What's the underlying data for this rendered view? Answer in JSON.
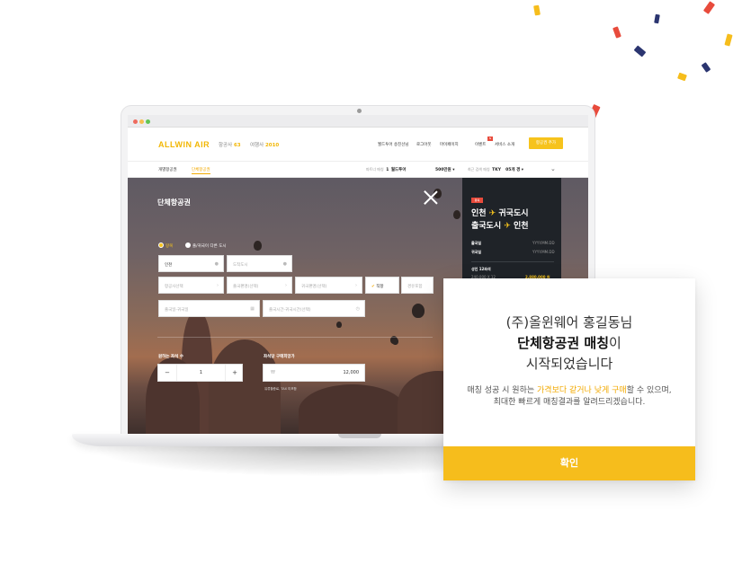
{
  "app": {
    "logo": "ALLWIN AIR",
    "stats": [
      {
        "label": "항공사",
        "value": "63"
      },
      {
        "label": "여행사",
        "value": "2010"
      }
    ],
    "nav_links": [
      "월드투어 송진선님",
      "로그아웃",
      "마이페이지",
      "이벤트",
      "서비스 소개"
    ],
    "nav_button": "항공권 추가",
    "new_badge": "N"
  },
  "subnav": {
    "tabs": [
      "개별항공권",
      "단체항공권"
    ],
    "active_tab": "단체항공권",
    "info_items": [
      {
        "label": "파트너 매칭",
        "value": "1",
        "extra": "월드투어"
      },
      {
        "label": "",
        "value": "500만원 ▾",
        "extra": ""
      },
      {
        "label": "최근 검색 매칭",
        "value": "TKY",
        "extra": "05개 경 ▾"
      }
    ]
  },
  "form": {
    "title": "단체항공권",
    "radios": [
      {
        "label": "왕복",
        "checked": true
      },
      {
        "label": "출/귀국이 다른 도시",
        "checked": false
      }
    ],
    "origin": "인천",
    "destination_placeholder": "도착도시",
    "airline_placeholder": "항공사선택",
    "depart_flight_placeholder": "출국편명(선택)",
    "return_flight_placeholder": "귀국편명(선택)",
    "direct_label": "직항",
    "transit_label": "경유포함",
    "date_placeholder": "출국일-귀국일",
    "time_placeholder": "출국시간-귀국시간(선택)",
    "seats_label": "원하는 좌석 수",
    "seats_value": "1",
    "price_label": "좌석당 구매희망가",
    "price_currency": "₩",
    "price_value": "12,000",
    "price_note": "유류할증료, TAX 미포함"
  },
  "side": {
    "badge": "왕복",
    "route_line1_from": "인천",
    "route_line1_to": "귀국도시",
    "route_line2_from": "출국도시",
    "route_line2_to": "인천",
    "arrow": "✈",
    "depart_label": "출국일",
    "depart_value": "YYYY.MM.DD",
    "return_label": "귀국일",
    "return_value": "YYYY.MM.DD",
    "adult_label": "성인 12좌석",
    "adult_hl": "12",
    "amount_left": "240,000 X 12",
    "amount_right": "2,880,000 원"
  },
  "modal": {
    "line1": "(주)올윈웨어 홍길동님",
    "line2_bold": "단체항공권 매칭",
    "line2_rest": "이",
    "line3": "시작되었습니다",
    "body1_pre": "매칭 성공 시 원하는 ",
    "body1_hl": "가격보다 같거나 낮게 구매",
    "body1_post": "할 수 있으며,",
    "body2": "최대한 빠르게 매칭결과를 알려드리겠습니다.",
    "confirm": "확인"
  },
  "colors": {
    "accent": "#f6bd1c",
    "accent_text": "#f2a900",
    "badge_red": "#e84b3c",
    "side_dark": "#1f2328",
    "confetti": [
      "#f6bd1c",
      "#e84b3c",
      "#2b3570"
    ]
  }
}
